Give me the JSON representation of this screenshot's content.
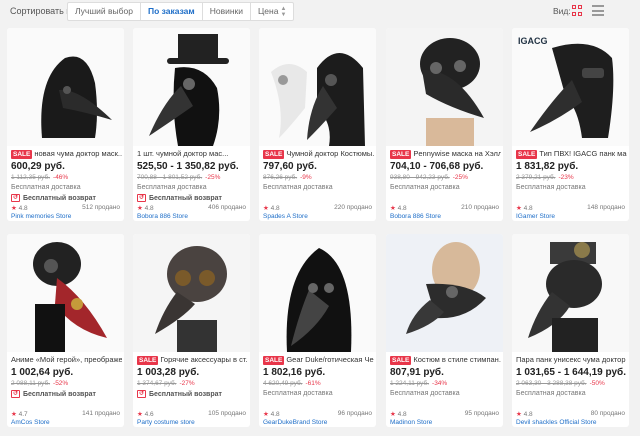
{
  "toolbar": {
    "sort_label": "Сортировать по:",
    "sort_options": [
      "Лучший выбор",
      "По заказам",
      "Новинки",
      "Цена"
    ],
    "view_label": "Вид:"
  },
  "colors": {
    "accent": "#e8364a",
    "link": "#1e6ec8"
  },
  "products": [
    {
      "sale": "SALE",
      "title": "новая чума доктор маск...",
      "price": "600,29 руб.",
      "old_price": "1 112,35 руб.",
      "discount": "-46%",
      "shipping": "Бесплатная доставка",
      "free_return": "Бесплатный возврат",
      "rating": "4.8",
      "sold": "512 продано",
      "store": "Pink memories Store",
      "icon": "hooded-plague-mask"
    },
    {
      "sale": "",
      "title": "1 шт. чумной доктор мас...",
      "price": "525,50 - 1 350,82 руб.",
      "old_price": "700,88 - 1 801,52 руб.",
      "discount": "-25%",
      "shipping": "Бесплатная доставка",
      "free_return": "Бесплатный возврат",
      "rating": "4.8",
      "sold": "406 продано",
      "store": "Bobora 886 Store",
      "icon": "top-hat-plague-mask"
    },
    {
      "sale": "SALE",
      "title": "Чумной доктор Костюмы...",
      "price": "797,60 руб.",
      "old_price": "876,26 руб.",
      "discount": "-9%",
      "shipping": "Бесплатная доставка",
      "free_return": "",
      "rating": "4.8",
      "sold": "220 продано",
      "store": "Spades A Store",
      "icon": "white-and-black-masks"
    },
    {
      "sale": "SALE",
      "title": "Pennywise маска на Хэлл...",
      "price": "704,10 - 706,68 руб.",
      "old_price": "938,80 - 942,23 руб.",
      "discount": "-25%",
      "shipping": "Бесплатная доставка",
      "free_return": "",
      "rating": "4.8",
      "sold": "210 продано",
      "store": "Bobora 886 Store",
      "icon": "studded-plague-mask"
    },
    {
      "sale": "SALE",
      "title": "Тип ПВХ! IGACG панк мас...",
      "price": "1 831,82 руб.",
      "old_price": "2 379,21 руб.",
      "discount": "-23%",
      "shipping": "Бесплатная доставка",
      "free_return": "",
      "rating": "4.8",
      "sold": "148 продано",
      "store": "IGamer Store",
      "icon": "pvc-plague-mask",
      "brand": "IGACG"
    },
    {
      "sale": "",
      "title": "Аниме «Мой герой», преображе...",
      "price": "1 002,64 руб.",
      "old_price": "2 088,11 руб.",
      "discount": "-52%",
      "shipping": "",
      "free_return": "Бесплатный возврат",
      "rating": "4.7",
      "sold": "141 продано",
      "store": "AmCos Store",
      "icon": "red-gear-plague-mask"
    },
    {
      "sale": "SALE",
      "title": "Горячие аксессуары в ст...",
      "price": "1 003,28 руб.",
      "old_price": "1 374,67 руб.",
      "discount": "-27%",
      "shipping": "",
      "free_return": "Бесплатный возврат",
      "rating": "4.6",
      "sold": "105 продано",
      "store": "Party costume store",
      "icon": "goggle-plague-mask"
    },
    {
      "sale": "SALE",
      "title": "Gear Duke/готическая Че...",
      "price": "1 802,16 руб.",
      "old_price": "4 620,49 руб.",
      "discount": "-61%",
      "shipping": "Бесплатная доставка",
      "free_return": "",
      "rating": "4.8",
      "sold": "96 продано",
      "store": "GearDukeBrand Store",
      "icon": "gothic-hood-mask"
    },
    {
      "sale": "SALE",
      "title": "Костюм в стиле стимпан...",
      "price": "807,91 руб.",
      "old_price": "1 224,11 руб.",
      "discount": "-34%",
      "shipping": "Бесплатная доставка",
      "free_return": "",
      "rating": "4.8",
      "sold": "95 продано",
      "store": "Madinon Store",
      "icon": "steampunk-mask"
    },
    {
      "sale": "",
      "title": "Пара панк унисекс чума доктор ...",
      "price": "1 031,65 - 1 644,19 руб.",
      "old_price": "2 063,30 - 3 288,38 руб.",
      "discount": "-50%",
      "shipping": "Бесплатная доставка",
      "free_return": "",
      "rating": "4.8",
      "sold": "80 продано",
      "store": "Devil shackles Official Store",
      "icon": "gear-top-mask"
    }
  ]
}
